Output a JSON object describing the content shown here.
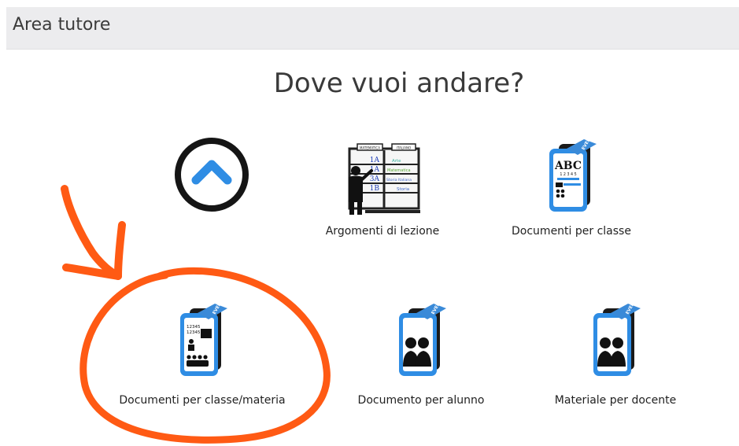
{
  "header": {
    "title": "Area tutore"
  },
  "page": {
    "heading": "Dove vuoi andare?"
  },
  "back": {
    "icon": "chevron-up-circle-icon"
  },
  "tiles": [
    {
      "label": "Argomenti di lezione",
      "icon": "teacher-board-icon"
    },
    {
      "label": "Documenti per classe",
      "icon": "abc-class-document-icon"
    },
    {
      "label": "Documenti per classe/materia",
      "icon": "class-subject-document-icon"
    },
    {
      "label": "Documento per alunno",
      "icon": "student-document-icon"
    },
    {
      "label": "Materiale per docente",
      "icon": "teacher-material-icon"
    }
  ],
  "board": {
    "headers": [
      "MATEMATICA",
      "ITALIANO"
    ],
    "rows": [
      [
        "1A",
        "Arte"
      ],
      [
        "1A",
        "Matematica"
      ],
      [
        "3A",
        "Storia Italiana"
      ],
      [
        "1B",
        "Storia"
      ]
    ]
  },
  "doc_text": {
    "tag": "EVENT",
    "abc": "ABC",
    "digits": "12345",
    "digits_row": "1 2 3 4 5"
  },
  "colors": {
    "accent_blue": "#2f8de4",
    "annotation_orange": "#ff5a14",
    "dark": "#1a1a1a"
  }
}
